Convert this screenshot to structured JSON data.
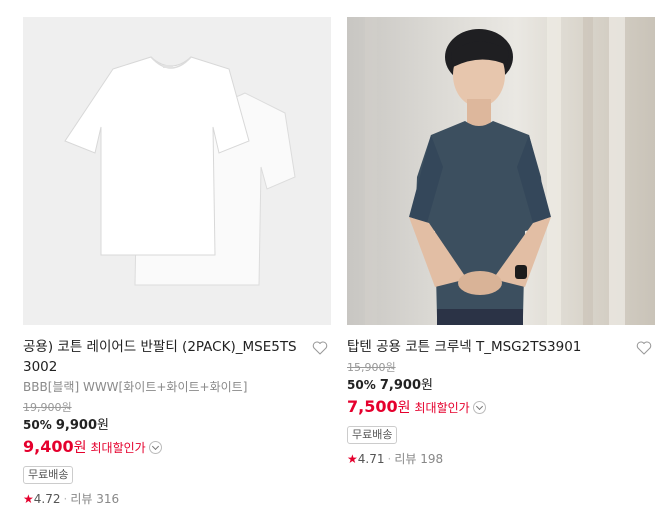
{
  "products": [
    {
      "title": "공용) 코튼 레이어드 반팔티 (2PACK)_MSE5TS3002",
      "option": "BBB[블랙] WWW[화이트+화이트+화이트]",
      "original_price": "19,900원",
      "discount_percent": "50%",
      "sale_price": "9,900",
      "sale_unit": "원",
      "max_discount_price": "9,400",
      "max_discount_unit": "원",
      "max_discount_label": "최대할인가",
      "badge": "무료배송",
      "star_icon": "★",
      "rating": "4.72",
      "review_label": "리뷰",
      "review_count": "316"
    },
    {
      "title": "탑텐 공용 코튼 크루넥 T_MSG2TS3901",
      "original_price": "15,900원",
      "discount_percent": "50%",
      "sale_price": "7,900",
      "sale_unit": "원",
      "max_discount_price": "7,500",
      "max_discount_unit": "원",
      "max_discount_label": "최대할인가",
      "badge": "무료배송",
      "star_icon": "★",
      "rating": "4.71",
      "review_label": "리뷰",
      "review_count": "198"
    }
  ],
  "colors": {
    "accent_red": "#e5002d",
    "tshirt_navy": "#3c4f5f",
    "tshirt_white": "#ffffff"
  }
}
